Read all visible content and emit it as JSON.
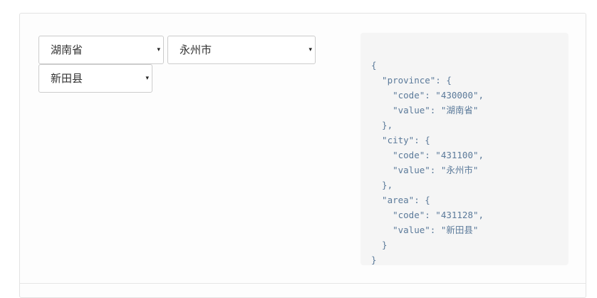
{
  "selectors": {
    "province": {
      "selected": "湖南省"
    },
    "city": {
      "selected": "永州市"
    },
    "area": {
      "selected": "新田县"
    }
  },
  "caret_glyph": "▾",
  "json_lines": [
    "{",
    "  \"province\": {",
    "    \"code\": \"430000\",",
    "    \"value\": \"湖南省\"",
    "  },",
    "  \"city\": {",
    "    \"code\": \"431100\",",
    "    \"value\": \"永州市\"",
    "  },",
    "  \"area\": {",
    "    \"code\": \"431128\",",
    "    \"value\": \"新田县\"",
    "  }",
    "}"
  ],
  "colors": {
    "code_text": "#5b7a9a",
    "code_background": "#f5f5f5",
    "border": "#cccccc"
  }
}
